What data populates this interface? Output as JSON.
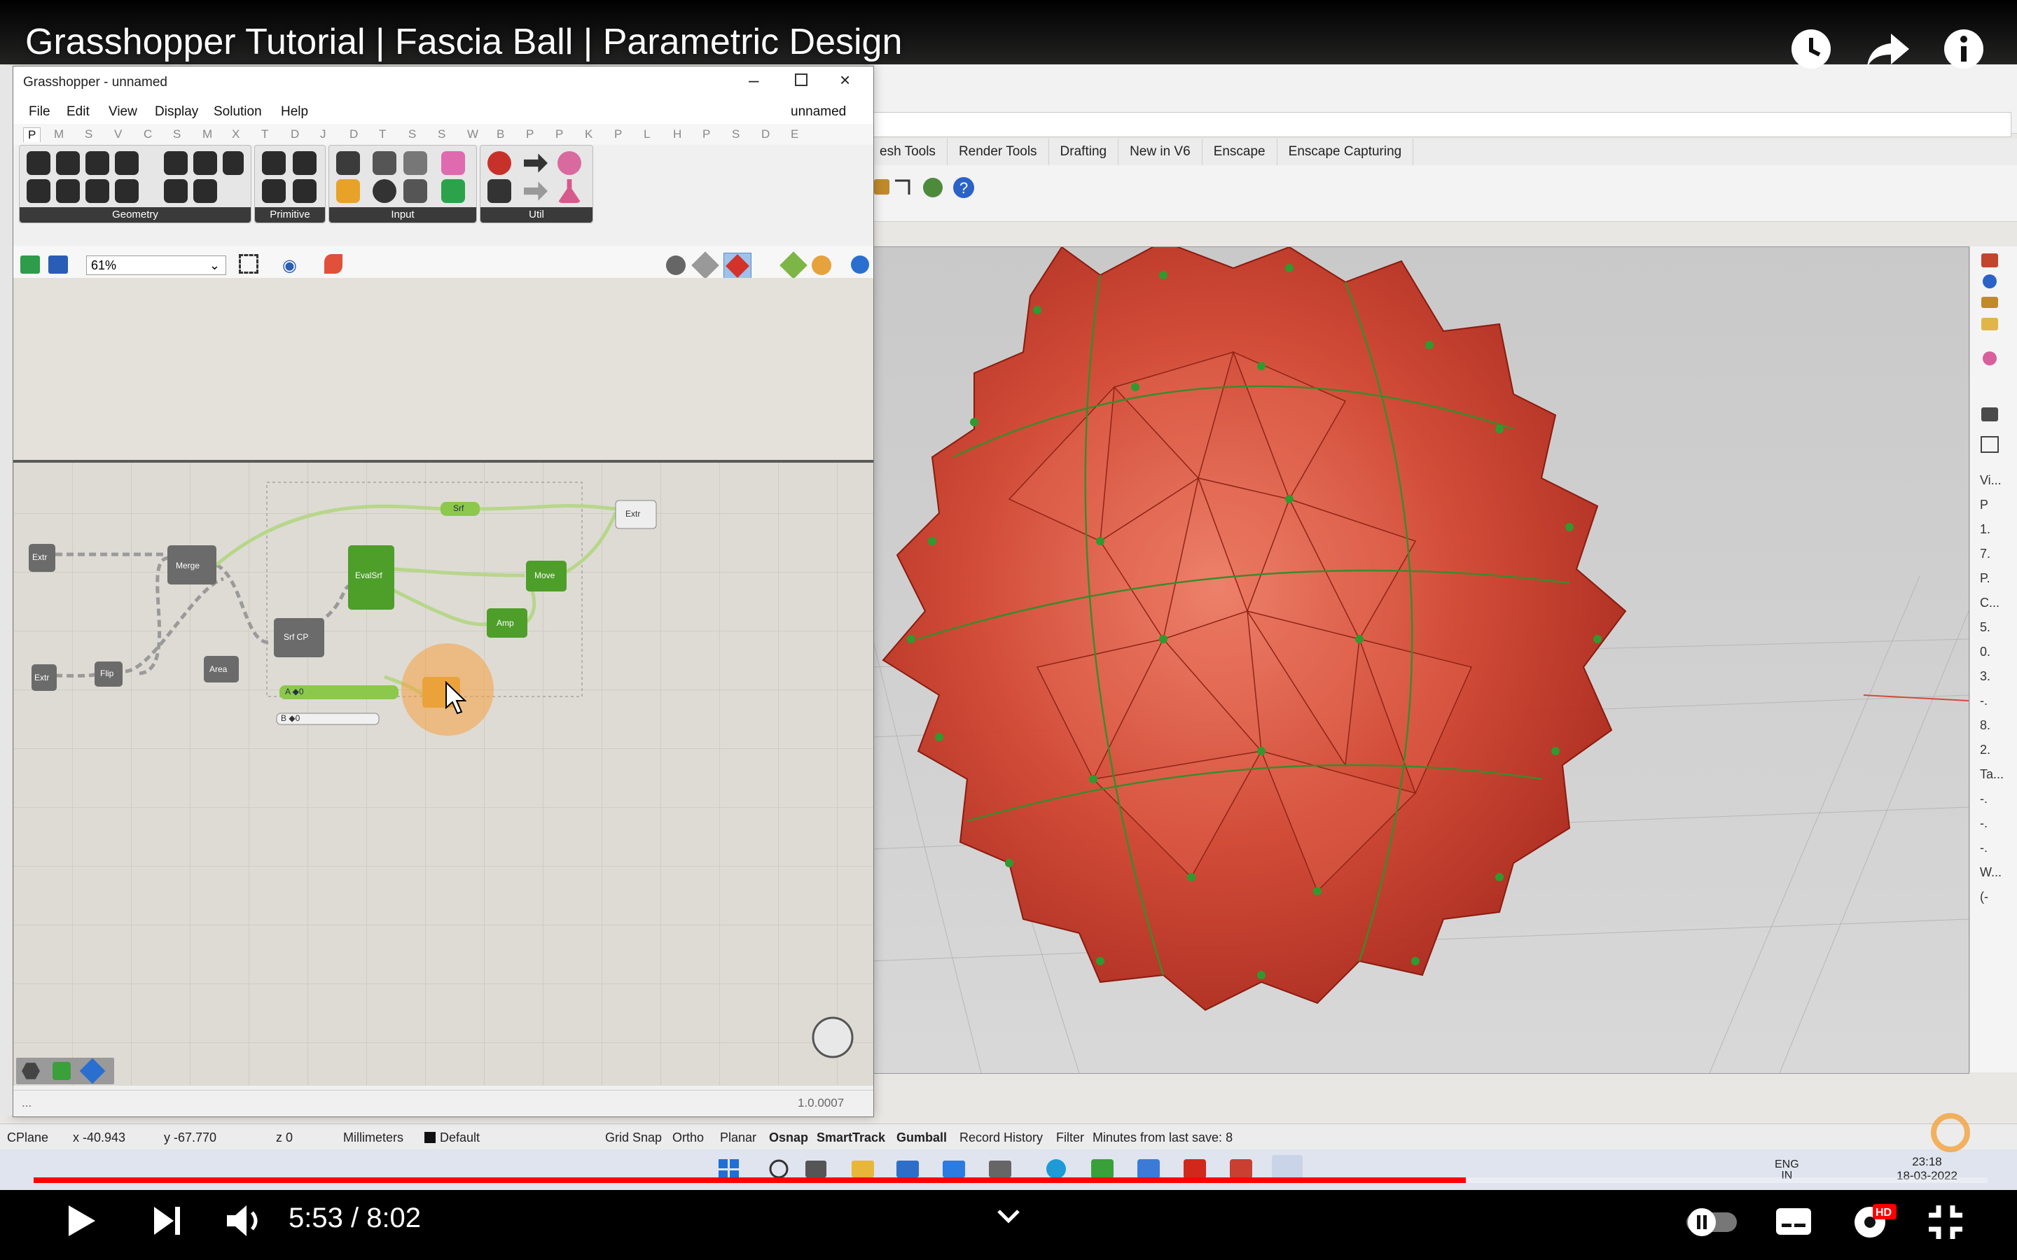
{
  "video": {
    "title": "Grasshopper Tutorial | Fascia Ball | Parametric Design",
    "time": "5:53 / 8:02",
    "progress": 0.733
  },
  "grasshopper": {
    "window_title": "Grasshopper - unnamed",
    "doc_name": "unnamed",
    "menu": [
      "File",
      "Edit",
      "View",
      "Display",
      "Solution",
      "Help"
    ],
    "tabs": [
      "P",
      "M",
      "S",
      "V",
      "C",
      "S",
      "M",
      "X",
      "T",
      "D",
      "J",
      "D",
      "T",
      "S",
      "S",
      "W",
      "B",
      "P",
      "P",
      "K",
      "P",
      "L",
      "H",
      "P",
      "S",
      "D",
      "E"
    ],
    "ribbon_groups": [
      "Geometry",
      "Primitive",
      "Input",
      "Util"
    ],
    "zoom": "61%",
    "status_left": "...",
    "version": "1.0.0007",
    "components": {
      "explode1": "Extr",
      "merge": "Merge",
      "explode2": "Extr",
      "flip": "Flip",
      "area": "Area",
      "surface_cp": "Srf CP",
      "evalsrf": "EvalSrf",
      "srf": "Srf",
      "move": "Move",
      "amp": "Amp",
      "extr": "Extr",
      "slider1": "A ◆0",
      "slider2": "B ◆0"
    }
  },
  "rhino": {
    "tabs": [
      "esh Tools",
      "Render Tools",
      "Drafting",
      "New in V6",
      "Enscape",
      "Enscape Capturing"
    ],
    "right_panel": [
      "Vi...",
      "P",
      "1.",
      "7.",
      "P.",
      "C...",
      "5.",
      "0.",
      "3.",
      "-.",
      "8.",
      "2.",
      "Ta...",
      "-.",
      "-.",
      "-.",
      "W...",
      "(-"
    ],
    "status": {
      "cplane": "CPlane",
      "x": "x -40.943",
      "y": "y -67.770",
      "z": "z 0",
      "units": "Millimeters",
      "layer": "Default",
      "toggles": [
        "Grid Snap",
        "Ortho",
        "Planar",
        "Osnap",
        "SmartTrack",
        "Gumball",
        "Record History",
        "Filter"
      ],
      "bold_toggles": [
        "Osnap",
        "SmartTrack",
        "Gumball"
      ],
      "save_info": "Minutes from last save: 8"
    }
  },
  "taskbar": {
    "lang": "ENG",
    "region": "IN",
    "clock": "23:18",
    "date": "18-03-2022"
  },
  "colors": {
    "youtube_red": "#ff0000",
    "gh_green": "#7fc23b",
    "ball_red": "#c4301e",
    "point_green": "#2f9a2f"
  }
}
